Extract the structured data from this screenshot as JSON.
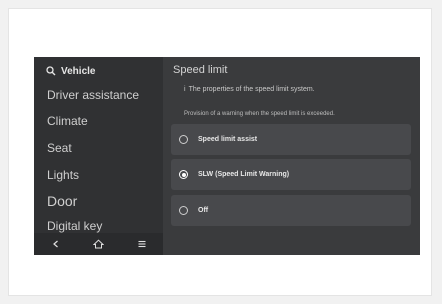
{
  "sidebar": {
    "search_label": "Vehicle",
    "items": [
      {
        "label": "Driver assistance"
      },
      {
        "label": "Climate"
      },
      {
        "label": "Seat"
      },
      {
        "label": "Lights"
      },
      {
        "label": "Door"
      },
      {
        "label": "Digital key"
      }
    ]
  },
  "nav_icons": [
    "back-icon",
    "home-icon",
    "menu-icon"
  ],
  "panel": {
    "title": "Speed limit",
    "info_marker": "i",
    "description": "The properties of the speed limit system.",
    "subtext": "Provision of a warning when the speed limit is exceeded.",
    "options": [
      {
        "label": "Speed limit assist",
        "selected": false
      },
      {
        "label": "SLW (Speed Limit Warning)",
        "selected": true
      },
      {
        "label": "Off",
        "selected": false
      }
    ]
  },
  "colors": {
    "screen_bg": "#3a3b3d",
    "sidebar_bg": "#303133",
    "option_bg": "#48494c",
    "text": "#e8e8e8"
  }
}
